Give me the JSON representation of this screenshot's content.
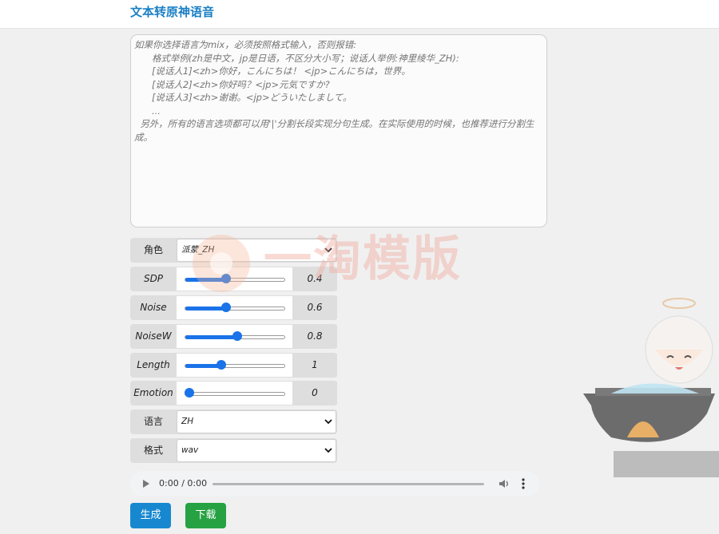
{
  "header": {
    "title": "文本转原神语音"
  },
  "input": {
    "placeholder": "如果你选择语言为mix，必须按照格式输入，否则报错:\n      格式举例(zh是中文，jp是日语，不区分大小写；说话人举例:神里绫华_ZH):\n      [说话人1]<zh>你好，こんにちは！ <jp>こんにちは，世界。\n      [说话人2]<zh>你好吗？<jp>元気ですか?\n      [说话人3]<zh>谢谢。<jp>どういたしまして。\n      ...\n  另外，所有的语言选项都可以用'|'分割长段实现分句生成。在实际使用的时候，也推荐进行分割生成。",
    "value": ""
  },
  "controls": {
    "speaker": {
      "label": "角色",
      "value": "派蒙_ZH"
    },
    "sdp_ratio": {
      "label": "SDP Ratio",
      "value": "0.4",
      "level": 0.4
    },
    "noise": {
      "label": "Noise",
      "value": "0.6",
      "level": 0.4
    },
    "noise_w": {
      "label": "NoiseW",
      "value": "0.8",
      "level": 0.53
    },
    "length": {
      "label": "Length",
      "value": "1",
      "level": 0.35
    },
    "emotion": {
      "label": "Emotion",
      "value": "0",
      "level": 0.0
    },
    "language": {
      "label": "语言",
      "value": "ZH"
    },
    "format": {
      "label": "格式",
      "value": "wav"
    }
  },
  "audio": {
    "time": "0:00 / 0:00"
  },
  "buttons": {
    "generate": "生成",
    "download": "下载"
  },
  "watermark": {
    "text": "一淘模版"
  },
  "colors": {
    "accent": "#1a73e8",
    "generate": "#1788d0",
    "download": "#27a243",
    "title": "#1a7fc4"
  }
}
